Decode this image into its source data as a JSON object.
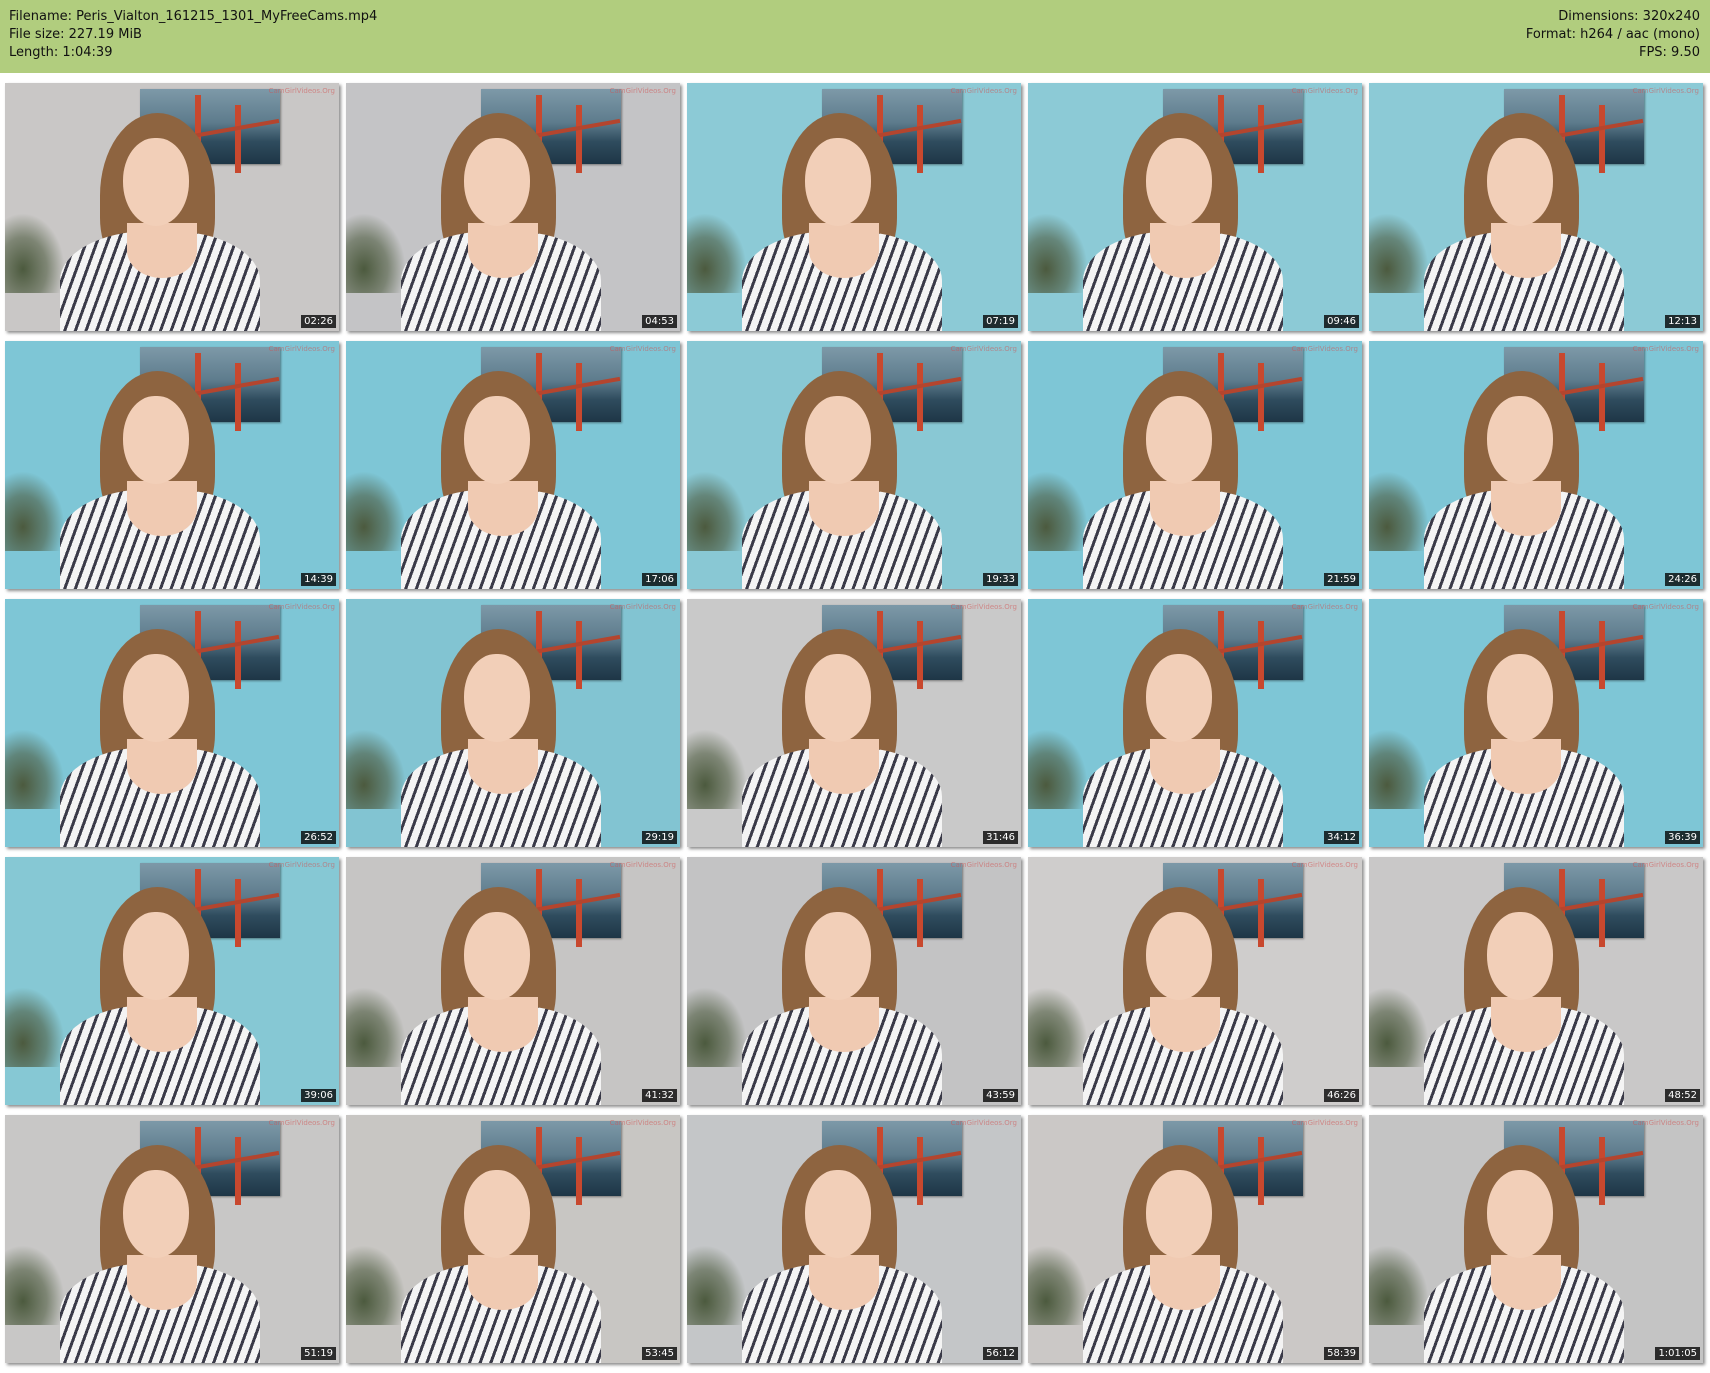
{
  "header": {
    "filename": "Filename: Peris_Vialton_161215_1301_MyFreeCams.mp4",
    "filesize": "File size: 227.19 MiB",
    "length": "Length: 1:04:39",
    "dimensions": "Dimensions: 320x240",
    "format": "Format: h264 / aac (mono)",
    "fps": "FPS: 9.50"
  },
  "colors": {
    "header_bg": "#b1cd7e",
    "page_bg": "#ffffff",
    "timestamp_bg": "#000000",
    "timestamp_text": "#ffffff"
  },
  "thumbnails": [
    {
      "time": "02:26",
      "wall": "#c9c7c6",
      "watermark": "CamGirlVideos.Org"
    },
    {
      "time": "04:53",
      "wall": "#c4c4c6",
      "watermark": "CamGirlVideos.Org"
    },
    {
      "time": "07:19",
      "wall": "#8ccad6",
      "watermark": "CamGirlVideos.Org"
    },
    {
      "time": "09:46",
      "wall": "#8ccad6",
      "watermark": "CamGirlVideos.Org"
    },
    {
      "time": "12:13",
      "wall": "#8ccad6",
      "watermark": "CamGirlVideos.Org"
    },
    {
      "time": "14:39",
      "wall": "#7ec6d6",
      "watermark": "CamGirlVideos.Org"
    },
    {
      "time": "17:06",
      "wall": "#7ec6d6",
      "watermark": "CamGirlVideos.Org"
    },
    {
      "time": "19:33",
      "wall": "#89c8d4",
      "watermark": "CamGirlVideos.Org"
    },
    {
      "time": "21:59",
      "wall": "#7ec6d6",
      "watermark": "CamGirlVideos.Org"
    },
    {
      "time": "24:26",
      "wall": "#7ec6d6",
      "watermark": "CamGirlVideos.Org"
    },
    {
      "time": "26:52",
      "wall": "#7ec6d6",
      "watermark": "CamGirlVideos.Org"
    },
    {
      "time": "29:19",
      "wall": "#82c4d2",
      "watermark": "CamGirlVideos.Org"
    },
    {
      "time": "31:46",
      "wall": "#c9c9c9",
      "watermark": "CamGirlVideos.Org"
    },
    {
      "time": "34:12",
      "wall": "#7ec6d6",
      "watermark": "CamGirlVideos.Org"
    },
    {
      "time": "36:39",
      "wall": "#7ec6d6",
      "watermark": "CamGirlVideos.Org"
    },
    {
      "time": "39:06",
      "wall": "#86c8d4",
      "watermark": "CamGirlVideos.Org"
    },
    {
      "time": "41:32",
      "wall": "#c6c5c4",
      "watermark": "CamGirlVideos.Org"
    },
    {
      "time": "43:59",
      "wall": "#c3c3c4",
      "watermark": "CamGirlVideos.Org"
    },
    {
      "time": "46:26",
      "wall": "#cfcdcc",
      "watermark": "CamGirlVideos.Org"
    },
    {
      "time": "48:52",
      "wall": "#c9c8c8",
      "watermark": "CamGirlVideos.Org"
    },
    {
      "time": "51:19",
      "wall": "#c8c7c6",
      "watermark": "CamGirlVideos.Org"
    },
    {
      "time": "53:45",
      "wall": "#c8c6c3",
      "watermark": "CamGirlVideos.Org"
    },
    {
      "time": "56:12",
      "wall": "#c4c6c8",
      "watermark": "CamGirlVideos.Org"
    },
    {
      "time": "58:39",
      "wall": "#cbc8c6",
      "watermark": "CamGirlVideos.Org"
    },
    {
      "time": "1:01:05",
      "wall": "#c4c4c4",
      "watermark": "CamGirlVideos.Org"
    }
  ]
}
